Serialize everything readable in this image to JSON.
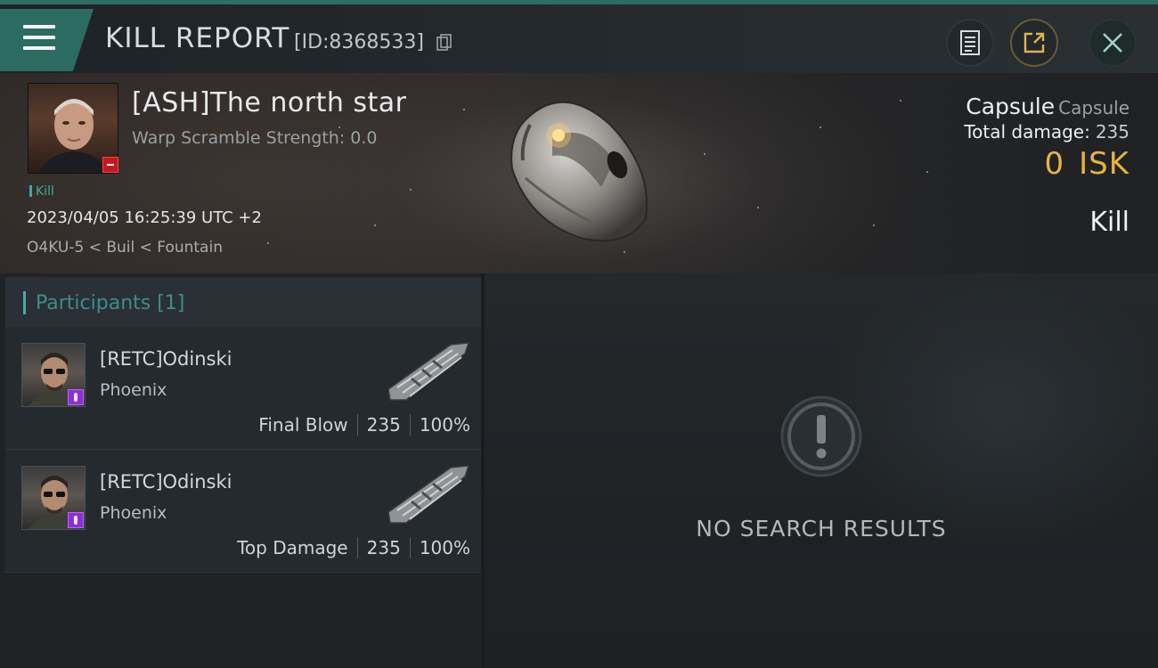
{
  "window": {
    "title": "KILL REPORT",
    "report_id": "[ID:8368533]"
  },
  "toolbar": {
    "menu_icon": "hamburger-menu-icon",
    "copy_icon": "copy-icon",
    "doc_icon": "document-icon",
    "share_icon": "share-external-icon",
    "close_icon": "close-icon"
  },
  "victim": {
    "name": "[ASH]The north star",
    "warp_scramble": "Warp Scramble Strength: 0.0",
    "kill_tag": "Kill",
    "datetime": "2023/04/05 16:25:39 UTC +2",
    "location": "O4KU-5 < Buil < Fountain",
    "ship_name": "Capsule",
    "ship_class": "Capsule",
    "total_damage_label": "Total damage:",
    "total_damage": "235",
    "isk_value": "0",
    "isk_unit": "ISK",
    "result": "Kill"
  },
  "participants": {
    "header": "Participants [1]",
    "rows": [
      {
        "name": "[RETC]Odinski",
        "ship": "Phoenix",
        "role": "Final Blow",
        "damage": "235",
        "percent": "100%"
      },
      {
        "name": "[RETC]Odinski",
        "ship": "Phoenix",
        "role": "Top Damage",
        "damage": "235",
        "percent": "100%"
      }
    ]
  },
  "results": {
    "empty_icon": "exclamation-circle-icon",
    "empty_text": "NO SEARCH RESULTS"
  },
  "colors": {
    "accent_teal": "#2c6b62",
    "isk_gold": "#e8b341",
    "loss_red": "#c7171d",
    "badge_purple": "#8d2fd6"
  }
}
